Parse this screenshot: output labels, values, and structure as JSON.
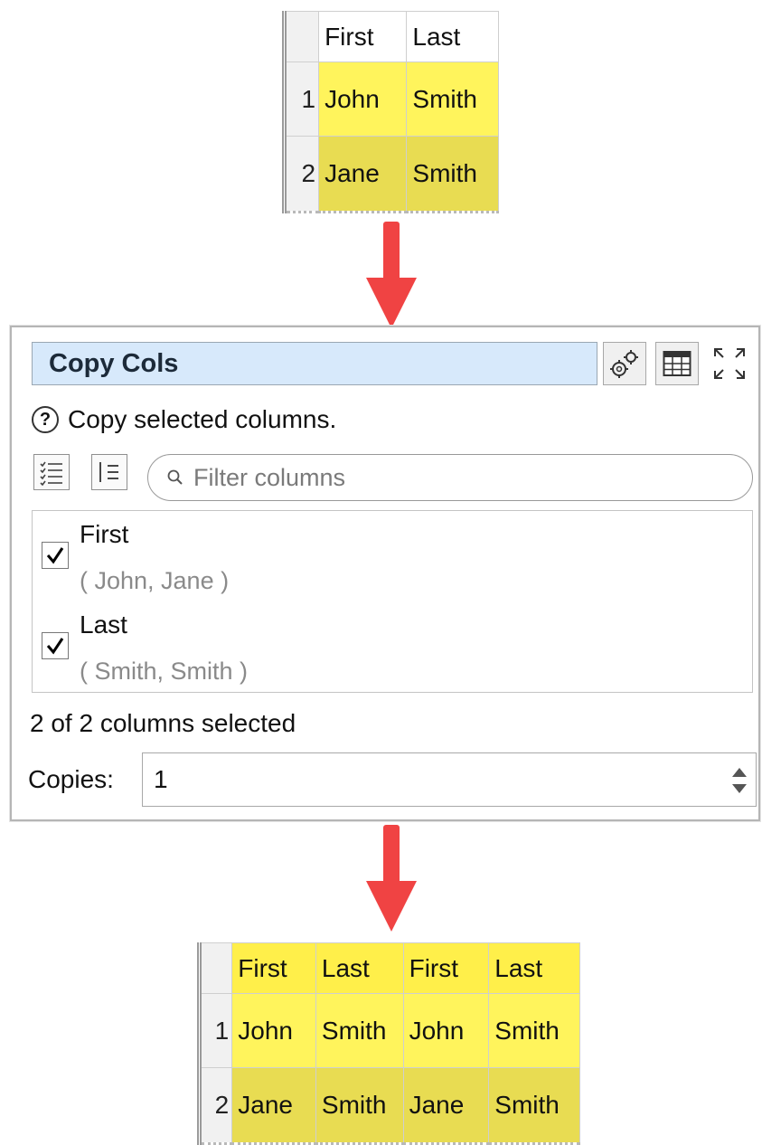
{
  "input_table": {
    "headers": [
      "First",
      "Last"
    ],
    "rows": [
      {
        "num": "1",
        "cells": [
          "John",
          "Smith"
        ]
      },
      {
        "num": "2",
        "cells": [
          "Jane",
          "Smith"
        ]
      }
    ]
  },
  "transform": {
    "title": "Copy Cols",
    "tool_icons": [
      "gears-icon",
      "table-icon",
      "expand-icon"
    ],
    "help_text": "Copy selected columns.",
    "filter": {
      "placeholder": "Filter columns",
      "value": ""
    },
    "columns": [
      {
        "name": "First",
        "values": "( John, Jane )",
        "checked": true
      },
      {
        "name": "Last",
        "values": "( Smith, Smith )",
        "checked": true
      }
    ],
    "status": "2 of 2 columns selected",
    "copies": {
      "label": "Copies:",
      "value": "1"
    }
  },
  "output_table": {
    "headers": [
      "First",
      "Last",
      "First",
      "Last"
    ],
    "rows": [
      {
        "num": "1",
        "cells": [
          "John",
          "Smith",
          "John",
          "Smith"
        ]
      },
      {
        "num": "2",
        "cells": [
          "Jane",
          "Smith",
          "Jane",
          "Smith"
        ]
      }
    ]
  },
  "colors": {
    "highlight": "#fff45c",
    "highlight_alt": "#e8dc52",
    "arrow": "#f04343",
    "title_bg": "#d7e9fb"
  }
}
